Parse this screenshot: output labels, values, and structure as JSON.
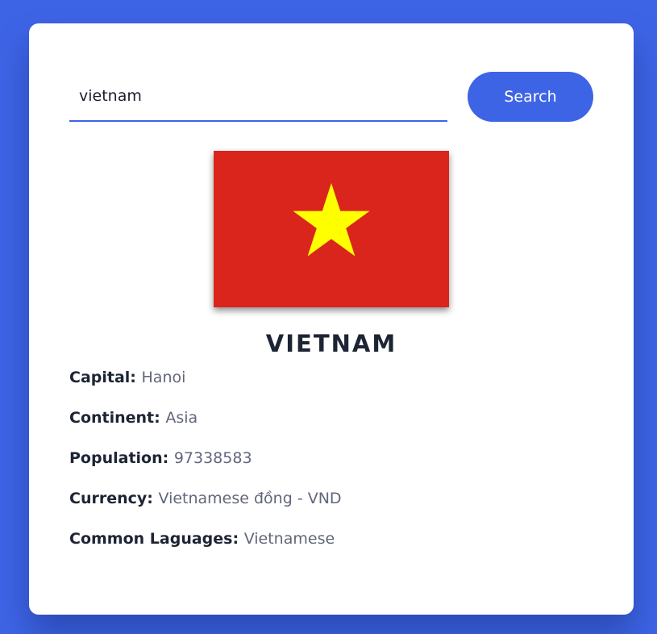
{
  "search": {
    "value": "vietnam",
    "button_label": "Search"
  },
  "country": {
    "name": "VIETNAM",
    "flag": {
      "background_color": "#da251d",
      "star_color": "#ffff00",
      "icon": "vietnam-flag-icon"
    }
  },
  "details": [
    {
      "label": "Capital:",
      "value": "Hanoi"
    },
    {
      "label": "Continent:",
      "value": "Asia"
    },
    {
      "label": "Population:",
      "value": "97338583"
    },
    {
      "label": "Currency:",
      "value": "Vietnamese đồng - VND"
    },
    {
      "label": "Common Laguages:",
      "value": "Vietnamese"
    }
  ],
  "colors": {
    "accent": "#3e64e6",
    "card_background": "#ffffff",
    "label_text": "#1d2433",
    "value_text": "#62667a"
  }
}
